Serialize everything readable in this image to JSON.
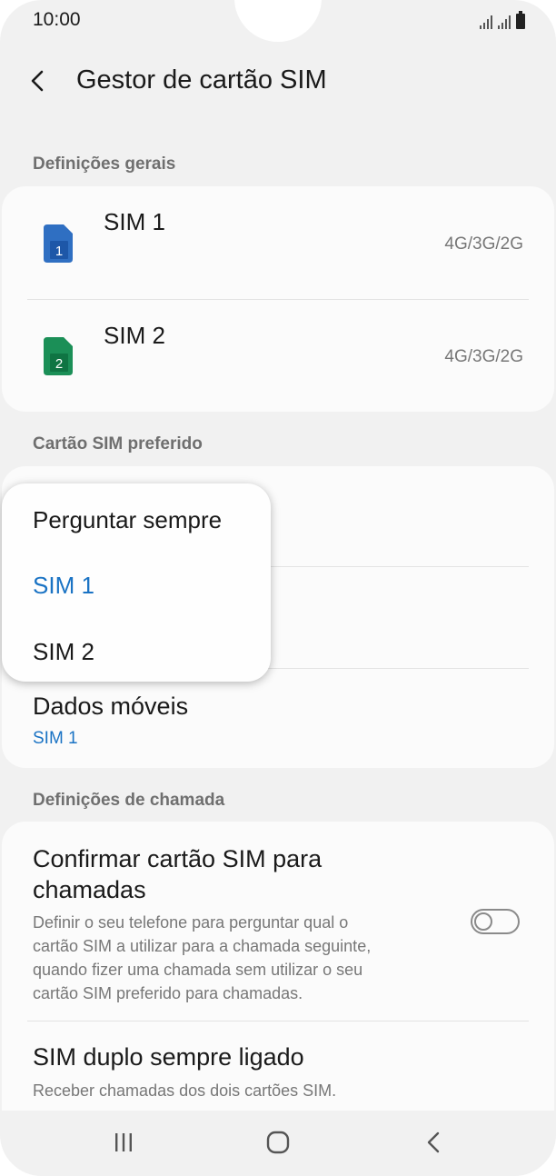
{
  "status": {
    "time": "10:00"
  },
  "header": {
    "title": "Gestor de cartão SIM"
  },
  "general": {
    "label": "Definições gerais",
    "sims": [
      {
        "title": "SIM 1",
        "number": "1",
        "type": "4G/3G/2G",
        "color": "#2f6fc2"
      },
      {
        "title": "SIM 2",
        "number": "2",
        "type": "4G/3G/2G",
        "color": "#1b8f57"
      }
    ]
  },
  "preferred": {
    "label": "Cartão SIM preferido",
    "mobile_data": {
      "title": "Dados móveis",
      "value": "SIM 1"
    }
  },
  "popup": {
    "options": [
      "Perguntar sempre",
      "SIM 1",
      "SIM 2"
    ],
    "selected": "SIM 1"
  },
  "calls": {
    "label": "Definições de chamada",
    "confirm": {
      "title_line1": "Confirmar cartão SIM para",
      "title_line2": "chamadas",
      "desc": [
        "Definir o seu telefone para perguntar qual o",
        "cartão SIM a utilizar para a chamada seguinte,",
        "quando fizer uma chamada sem utilizar o seu",
        "cartão SIM preferido para chamadas."
      ],
      "enabled": false
    },
    "dual": {
      "title": "SIM duplo sempre ligado",
      "desc": "Receber chamadas dos dois cartões SIM."
    }
  },
  "colors": {
    "accent": "#1a73c4",
    "background": "#f1f1f1",
    "card": "#fbfbfb"
  }
}
